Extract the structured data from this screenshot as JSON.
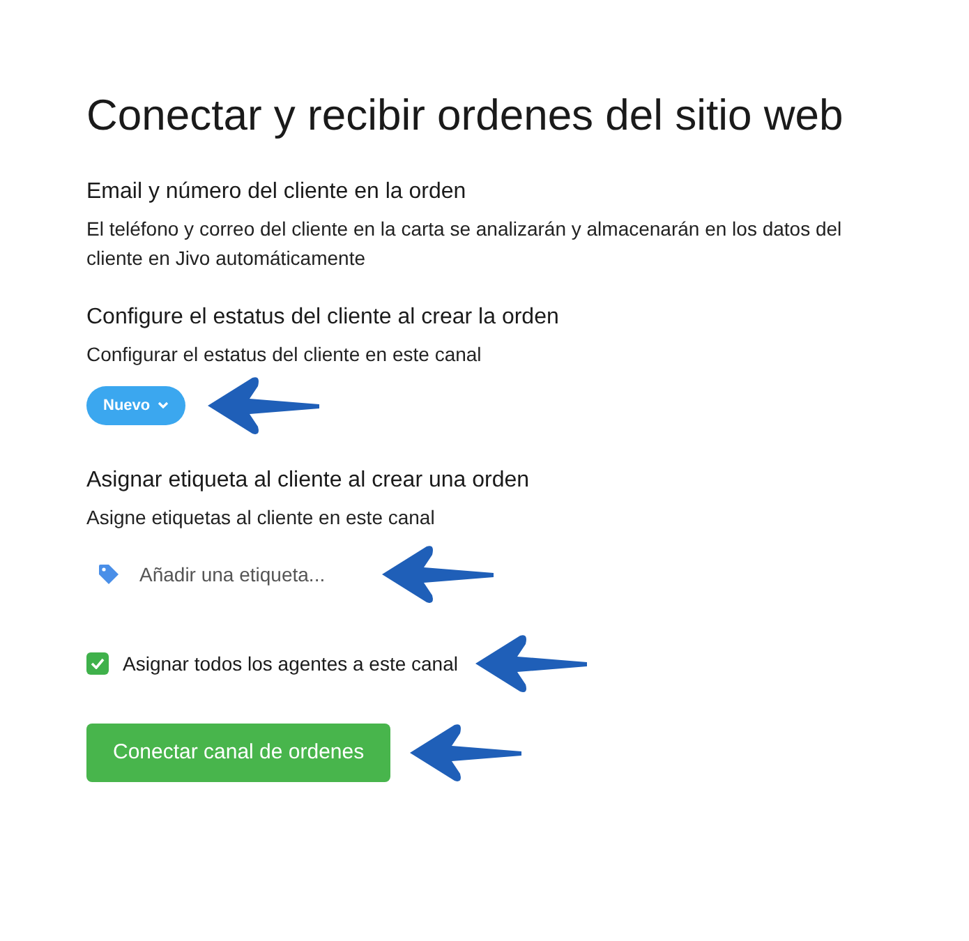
{
  "title": "Conectar y recibir ordenes del sitio web",
  "sections": [
    {
      "kind": "info",
      "heading": "Email y número del cliente en la orden",
      "description": "El teléfono y correo del cliente en la carta se analizarán y almacenarán en los datos del cliente en Jivo automáticamente"
    },
    {
      "kind": "status",
      "heading": "Configure el estatus del cliente al crear la orden",
      "description": "Configurar el estatus del cliente en este canal",
      "status": "Nuevo"
    },
    {
      "kind": "tags",
      "heading": "Asignar etiqueta al cliente al crear una orden",
      "description": "Asigne etiquetas al cliente en este canal",
      "placeholder": "Añadir una etiqueta..."
    }
  ],
  "checkbox": {
    "label": "Asignar todos los agentes a este canal",
    "checked": true
  },
  "button": "Conectar canal de ordenes"
}
